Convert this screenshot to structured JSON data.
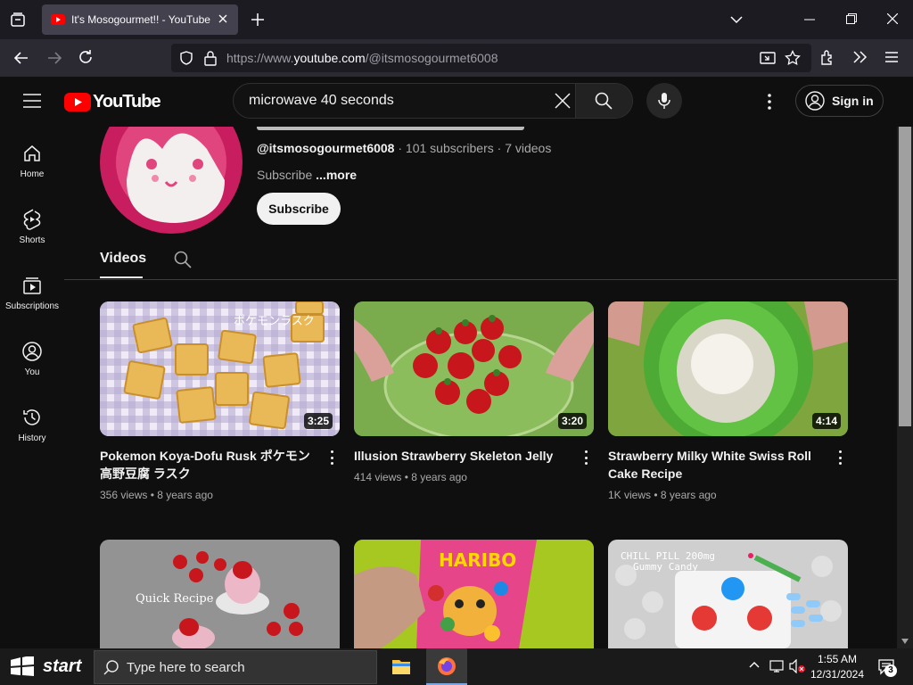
{
  "browser": {
    "tab_title": "It's Mosogourmet!! - YouTube",
    "url_prefix": "https://www.",
    "url_domain": "youtube.com",
    "url_path": "/@itsmosogourmet6008"
  },
  "youtube": {
    "logo_text": "YouTube",
    "search_value": "microwave 40 seconds",
    "signin_label": "Sign in"
  },
  "sidebar": {
    "items": [
      {
        "label": "Home",
        "icon": "home-icon"
      },
      {
        "label": "Shorts",
        "icon": "shorts-icon"
      },
      {
        "label": "Subscriptions",
        "icon": "subscriptions-icon"
      },
      {
        "label": "You",
        "icon": "you-icon"
      },
      {
        "label": "History",
        "icon": "history-icon"
      }
    ]
  },
  "channel": {
    "handle": "@itsmosogourmet6008",
    "stats": " · 101 subscribers · 7 videos",
    "desc": "Subscribe",
    "more": " ...more",
    "subscribe_label": "Subscribe",
    "tab_videos": "Videos"
  },
  "videos": [
    {
      "title": "Pokemon Koya-Dofu Rusk ポケモン 高野豆腐 ラスク",
      "meta": "356 views • 8 years ago",
      "duration": "3:25"
    },
    {
      "title": "Illusion Strawberry Skeleton Jelly",
      "meta": "414 views • 8 years ago",
      "duration": "3:20"
    },
    {
      "title": "Strawberry Milky White Swiss Roll Cake Recipe",
      "meta": "1K views • 8 years ago",
      "duration": "4:14"
    },
    {
      "title": "",
      "meta": "",
      "duration": ""
    },
    {
      "title": "",
      "meta": "",
      "duration": ""
    },
    {
      "title": "",
      "meta": "",
      "duration": ""
    }
  ],
  "thumb_text": {
    "t1": "ポケモンラスク",
    "t4": "Quick Recipe",
    "t5": "HARIBO",
    "t6a": "CHILL PILL 200mg",
    "t6b": "Gummy Candy"
  },
  "taskbar": {
    "start_label": "start",
    "search_placeholder": "Type here to search",
    "time": "1:55 AM",
    "date": "12/31/2024",
    "notif_count": "3"
  },
  "colors": {
    "youtube_red": "#ff0000",
    "background": "#0f0f0f"
  }
}
